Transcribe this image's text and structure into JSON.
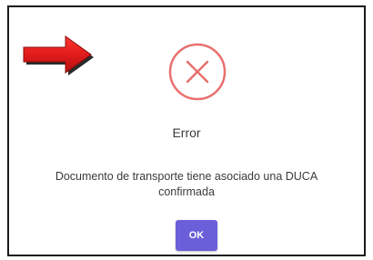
{
  "dialog": {
    "icon": "error-x-circle-icon",
    "title": "Error",
    "message": "Documento de transporte tiene asociado una DUCA confirmada",
    "ok_label": "OK"
  },
  "annotation": {
    "icon": "red-arrow-icon",
    "color": "#e01b1b"
  },
  "colors": {
    "error_accent": "#e8706f",
    "button_bg": "#6a5fd8",
    "text": "#3a3a3a"
  }
}
